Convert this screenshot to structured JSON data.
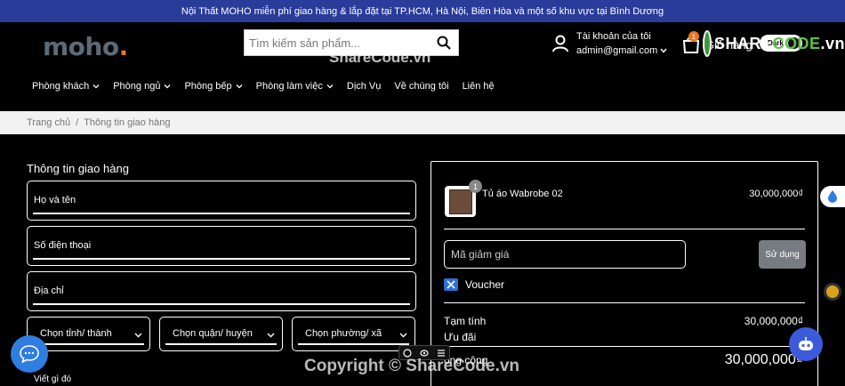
{
  "topbar": {
    "message": "Nội Thất MOHO miễn phí giao hàng & lắp đặt tại TP.HCM, Hà Nội, Biên Hòa và một số khu vực tại Bình Dương"
  },
  "header": {
    "logo_text": "moho",
    "logo_dot": ".",
    "search_placeholder": "Tìm kiếm sản phẩm...",
    "account_label": "Tài khoản của tôi",
    "account_user": "admin@gmail.com",
    "cart_label": "Giỏ hàng",
    "cart_count": "1",
    "theme_label": "Dark"
  },
  "nav": {
    "items": [
      {
        "label": "Phòng khách"
      },
      {
        "label": "Phòng ngủ"
      },
      {
        "label": "Phòng bếp"
      },
      {
        "label": "Phòng làm việc"
      },
      {
        "label": "Dịch Vụ"
      },
      {
        "label": "Về chúng tôi"
      },
      {
        "label": "Liên hệ"
      }
    ]
  },
  "breadcrumb": {
    "home": "Trang chủ",
    "sep": "/",
    "current": "Thông tin giao hàng"
  },
  "shipping": {
    "title": "Thông tin giao hàng",
    "name_label": "Họ và tên",
    "phone_label": "Số điện thoại",
    "address_label": "Địa chỉ",
    "province_label": "Chọn tỉnh/ thành",
    "district_label": "Chọn quận/ huyện",
    "ward_label": "Chọn phường/ xã",
    "note_label": "Viết gì đó"
  },
  "order": {
    "item_name": "Tủ áo Wabrobe 02",
    "item_price": "30,000,000₫",
    "item_qty": "1",
    "coupon_placeholder": "Mã giảm giá",
    "apply_label": "Sử dụng",
    "voucher_label": "Voucher",
    "subtotal_label": "Tạm tính",
    "subtotal_value": "30,000,000₫",
    "discount_label": "Ưu đãi",
    "discount_value": "-",
    "total_label": "ổng cộng",
    "total_value": "30,000,000₫"
  },
  "watermark": {
    "top": "ShareCode.vn",
    "bottom": "Copyright © ShareCode.vn",
    "logo_white": "SHARE",
    "logo_green": "CODE",
    "logo_suffix": ".vn"
  },
  "colors": {
    "topbar": "#2a3c9a",
    "accent": "#e8771e",
    "chat": "#2f7de1"
  }
}
